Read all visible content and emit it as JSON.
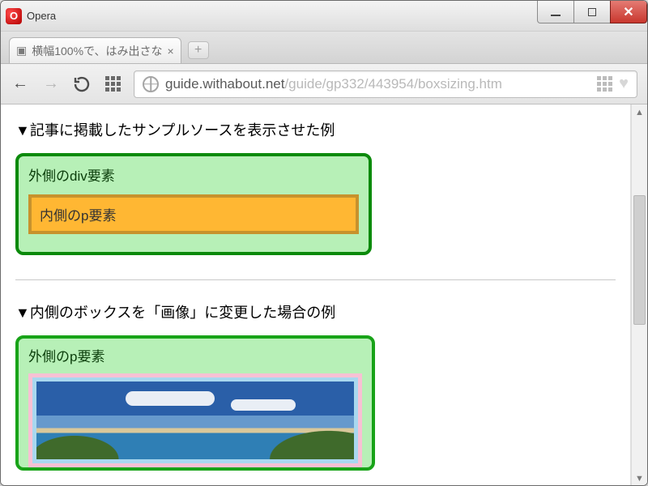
{
  "window": {
    "app_name": "Opera"
  },
  "tab": {
    "title": "横幅100%で、はみ出さな"
  },
  "url": {
    "scheme_host": "guide.withabout.net",
    "path": "/guide/gp332/443954/boxsizing.htm"
  },
  "page": {
    "section1_heading": "▼記事に掲載したサンプルソースを表示させた例",
    "sample1_outer_label": "外側のdiv要素",
    "sample1_inner_label": "内側のp要素",
    "section2_heading": "▼内側のボックスを「画像」に変更した場合の例",
    "sample2_outer_label": "外側のp要素"
  }
}
